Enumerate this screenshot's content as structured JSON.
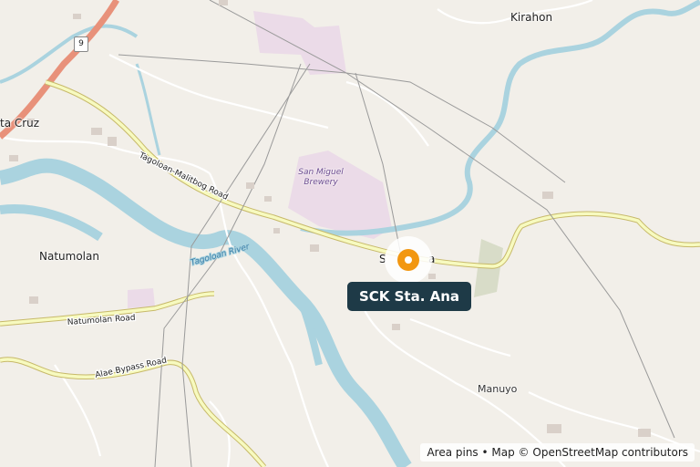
{
  "map": {
    "places": {
      "kirahon": "Kirahon",
      "santa_cruz": "ta Cruz",
      "natumolan": "Natumolan",
      "manuyo": "Manuyo",
      "sta_ana_partial": "S",
      "sta_ana_partial2": "a"
    },
    "roads": {
      "route_number": "9",
      "tagoloan_malitbog": "Tagoloan-Malitbog Road",
      "natumolan_road": "Natumolan Road",
      "alae_bypass": "Alae Bypass Road"
    },
    "river": "Tagoloan River",
    "poi": {
      "brewery_line1": "San Miguel",
      "brewery_line2": "Brewery"
    },
    "pin": {
      "label": "SCK Sta. Ana",
      "color": "#f29711"
    },
    "colors": {
      "land": "#f2efe9",
      "water": "#aad3df",
      "primary_road": "#f7fabf",
      "trunk_road": "#e8917a",
      "industrial": "#ebdbe8"
    }
  },
  "attribution": {
    "area_pins": "Area pins",
    "separator": "•",
    "map_credit": "Map © OpenStreetMap contributors"
  }
}
